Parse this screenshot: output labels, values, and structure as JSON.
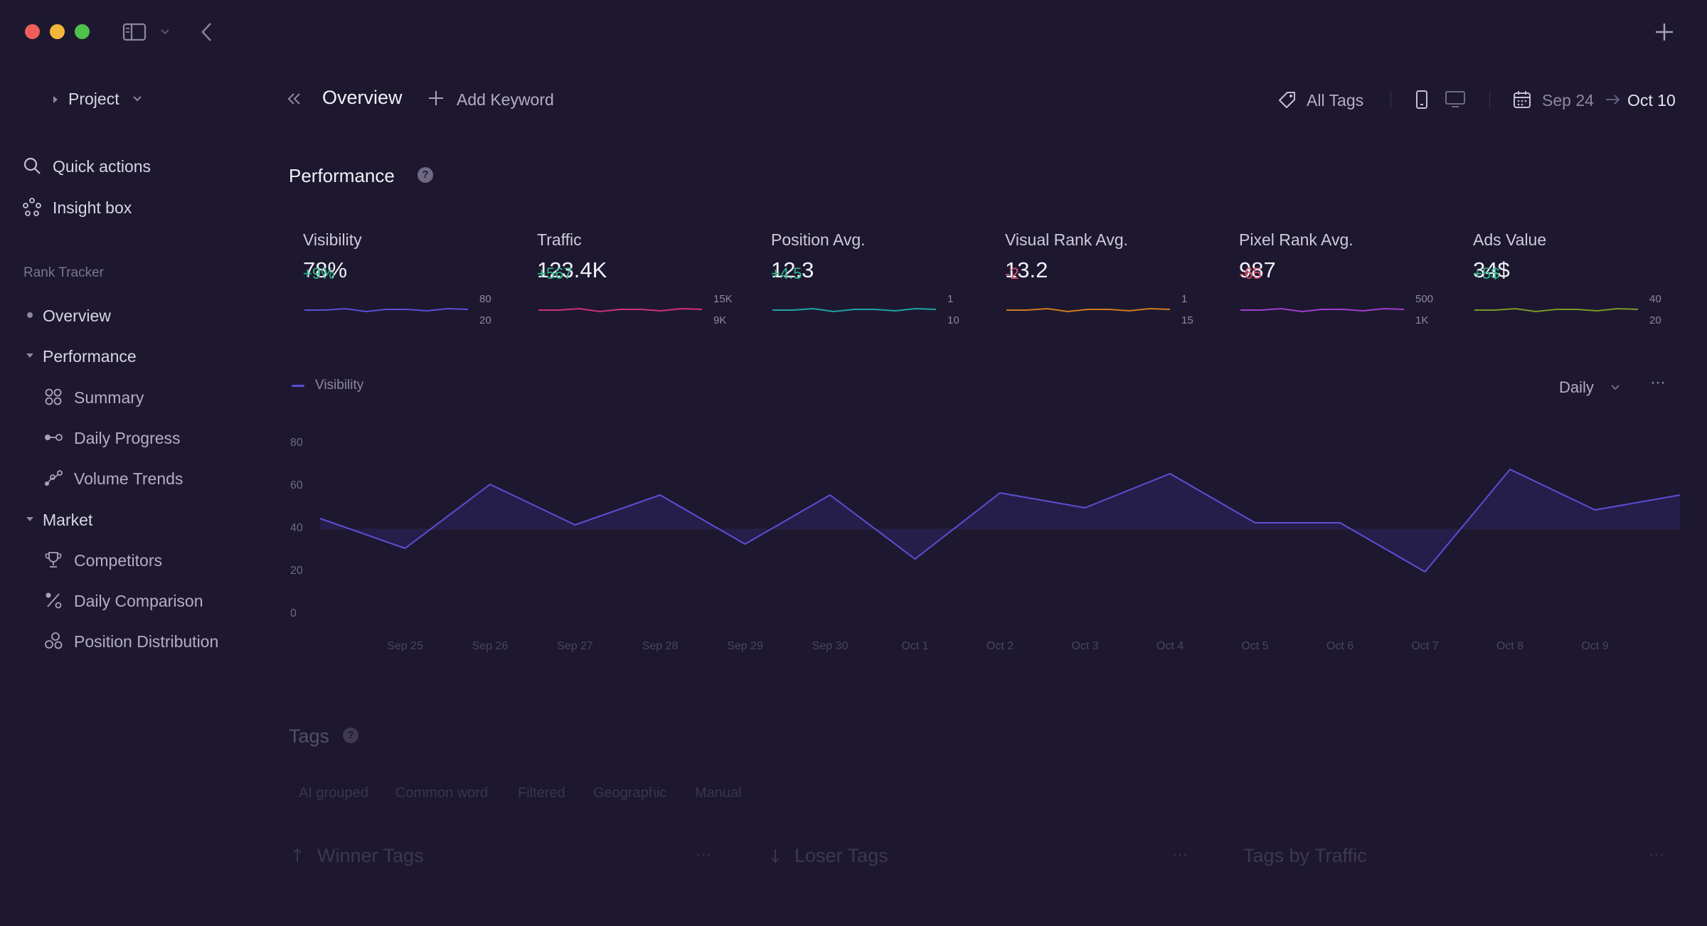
{
  "titlebar": {
    "traffic_colors": [
      "#ee5f5b",
      "#f2b73a",
      "#4fc24b"
    ]
  },
  "sidebar": {
    "project_label": "Project",
    "quick_actions": "Quick actions",
    "insight_box": "Insight box",
    "section_label": "Rank Tracker",
    "overview": "Overview",
    "performance": "Performance",
    "summary": "Summary",
    "daily_progress": "Daily Progress",
    "volume_trends": "Volume Trends",
    "market": "Market",
    "competitors": "Competitors",
    "daily_comparison": "Daily Comparison",
    "position_distribution": "Position Distribution"
  },
  "header": {
    "title": "Overview",
    "add_keyword": "Add Keyword",
    "all_tags": "All Tags",
    "date_from": "Sep 24",
    "date_to": "Oct 10"
  },
  "performance": {
    "title": "Performance",
    "metrics": [
      {
        "label": "Visibility",
        "value": "78%",
        "delta": "+9%",
        "trend": "pos",
        "hi": "80",
        "lo": "20",
        "color": "#5b4fd6"
      },
      {
        "label": "Traffic",
        "value": "123.4K",
        "delta": "+567",
        "trend": "pos",
        "hi": "15K",
        "lo": "9K",
        "color": "#d1307a"
      },
      {
        "label": "Position Avg.",
        "value": "12.3",
        "delta": "+4.5",
        "trend": "pos",
        "hi": "1",
        "lo": "10",
        "color": "#1fa3a6"
      },
      {
        "label": "Visual Rank Avg.",
        "value": "13.2",
        "delta": "-2",
        "trend": "neg",
        "hi": "1",
        "lo": "15",
        "color": "#d17a1f"
      },
      {
        "label": "Pixel Rank Avg.",
        "value": "987",
        "delta": "-65",
        "trend": "neg",
        "hi": "500",
        "lo": "1K",
        "color": "#a33ccf"
      },
      {
        "label": "Ads Value",
        "value": "34$",
        "delta": "+5$",
        "trend": "pos",
        "hi": "40",
        "lo": "20",
        "color": "#7a9a22"
      }
    ]
  },
  "chart_controls": {
    "legend_label": "Visibility",
    "interval": "Daily",
    "more": "···"
  },
  "chart_data": {
    "type": "area",
    "x": [
      "Sep 24",
      "Sep 25",
      "Sep 26",
      "Sep 27",
      "Sep 28",
      "Sep 29",
      "Sep 30",
      "Oct 1",
      "Oct 2",
      "Oct 3",
      "Oct 4",
      "Oct 5",
      "Oct 6",
      "Oct 7",
      "Oct 8",
      "Oct 9",
      "Oct 10"
    ],
    "x_tick_labels": [
      "Sep 25",
      "Sep 26",
      "Sep 27",
      "Sep 28",
      "Sep 29",
      "Sep 30",
      "Oct 1",
      "Oct 2",
      "Oct 3",
      "Oct 4",
      "Oct 5",
      "Oct 6",
      "Oct 7",
      "Oct 8",
      "Oct 9"
    ],
    "series": [
      {
        "name": "Visibility",
        "values": [
          45,
          31,
          61,
          42,
          56,
          33,
          56,
          26,
          57,
          50,
          66,
          43,
          43,
          20,
          68,
          49,
          56
        ],
        "color": "#5b4fd6"
      }
    ],
    "baseline": 40,
    "yticks": [
      "80",
      "60",
      "40",
      "20",
      "0"
    ],
    "ylim": [
      0,
      80
    ],
    "grid": false,
    "legend": "top-left"
  },
  "tags": {
    "title": "Tags",
    "filters": [
      "AI grouped",
      "Common word",
      "Filtered",
      "Geographic",
      "Manual"
    ],
    "winner": "Winner Tags",
    "loser": "Loser Tags",
    "by_traffic": "Tags by Traffic",
    "more": "···"
  }
}
